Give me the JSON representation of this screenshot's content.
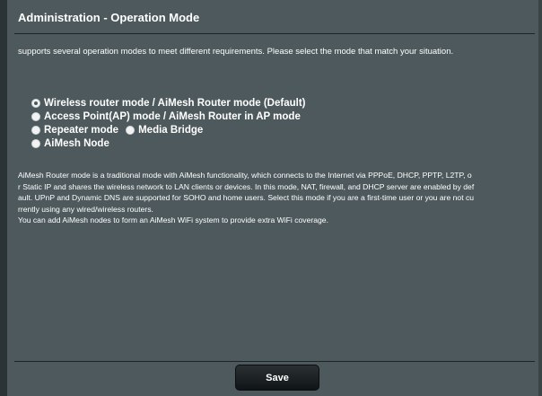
{
  "page": {
    "title": "Administration - Operation Mode",
    "intro": "supports several operation modes to meet different requirements. Please select the mode that match your situation."
  },
  "modes": [
    {
      "label": "Wireless router mode / AiMesh Router mode (Default)",
      "checked": true
    },
    {
      "label": "Access Point(AP) mode / AiMesh Router in AP mode",
      "checked": false
    },
    {
      "label": "Repeater mode",
      "checked": false
    },
    {
      "label": "Media Bridge",
      "checked": false
    },
    {
      "label": "AiMesh Node",
      "checked": false
    }
  ],
  "description": {
    "line1": "AiMesh Router mode is a traditional mode with AiMesh functionality, which connects to the Internet via PPPoE, DHCP, PPTP, L2TP, o",
    "line2": "r Static IP and shares the wireless network to LAN clients or devices. In this mode, NAT, firewall, and DHCP server are enabled by def",
    "line3": "ault. UPnP and Dynamic DNS are supported for SOHO and home users. Select this mode if you are a first-time user or you are not cu",
    "line4": "rrently using any wired/wireless routers.",
    "line5": "You can add AiMesh nodes to form an AiMesh WiFi system to provide extra WiFi coverage."
  },
  "footer": {
    "save_label": "Save"
  },
  "colors": {
    "background": "#4d595c",
    "text": "#ffffff",
    "button": "#101416"
  }
}
